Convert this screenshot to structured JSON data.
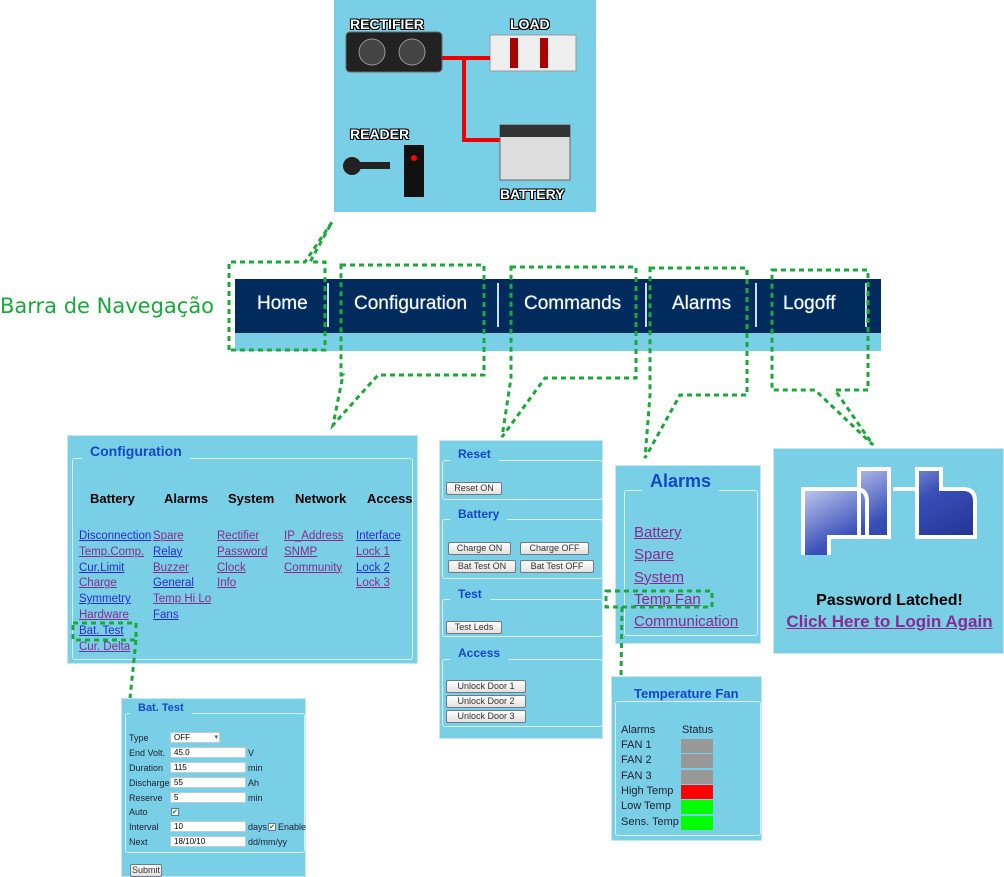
{
  "home": {
    "rectifier": "RECTIFIER",
    "load": "LOAD",
    "reader": "READER",
    "battery": "BATTERY"
  },
  "nav_label": "Barra de Navegação",
  "nav": [
    "Home",
    "Configuration",
    "Commands",
    "Alarms",
    "Logoff"
  ],
  "config": {
    "title": "Configuration",
    "columns": [
      {
        "header": "Battery",
        "links": [
          "Disconnection",
          "Temp.Comp.",
          "Cur.Limit",
          "Charge",
          "Symmetry",
          "Hardware",
          "Bat. Test",
          "Cur. Delta"
        ]
      },
      {
        "header": "Alarms",
        "links": [
          "Spare",
          "Relay",
          "Buzzer",
          "General",
          "Temp Hi Lo",
          "Fans"
        ]
      },
      {
        "header": "System",
        "links": [
          "Rectifier",
          "Password",
          "Clock",
          "Info"
        ]
      },
      {
        "header": "Network",
        "links": [
          "IP_Address",
          "SNMP",
          "Community"
        ]
      },
      {
        "header": "Access",
        "links": [
          "Interface",
          "Lock 1",
          "Lock 2",
          "Lock 3"
        ]
      }
    ]
  },
  "battest": {
    "title": "Bat. Test",
    "type_label": "Type",
    "type_value": "OFF",
    "fields": [
      {
        "label": "End Volt.",
        "value": "45.0",
        "unit": "V"
      },
      {
        "label": "Duration",
        "value": "115",
        "unit": "min"
      },
      {
        "label": "Discharge",
        "value": "55",
        "unit": "Ah"
      },
      {
        "label": "Reserve",
        "value": "5",
        "unit": "min"
      }
    ],
    "auto_label": "Auto",
    "interval_label": "Interval",
    "interval_value": "10",
    "interval_unit": "days",
    "enable_label": "Enable",
    "next_label": "Next",
    "next_value": "18/10/10",
    "next_unit": "dd/mm/yy",
    "submit": "Submit"
  },
  "commands": {
    "reset_title": "Reset",
    "reset_on": "Reset ON",
    "battery_title": "Battery",
    "charge_on": "Charge ON",
    "charge_off": "Charge OFF",
    "battest_on": "Bat Test ON",
    "battest_off": "Bat Test OFF",
    "test_title": "Test",
    "test_leds": "Test Leds",
    "access_title": "Access",
    "doors": [
      "Unlock Door 1",
      "Unlock Door 2",
      "Unlock Door 3"
    ]
  },
  "alarms": {
    "title": "Alarms",
    "links": [
      "Battery",
      "Spare",
      "System",
      "Temp Fan",
      "Communication"
    ]
  },
  "tempfan": {
    "title": "Temperature Fan",
    "col_alarms": "Alarms",
    "col_status": "Status",
    "rows": [
      {
        "name": "FAN 1",
        "color": "#999999"
      },
      {
        "name": "FAN 2",
        "color": "#999999"
      },
      {
        "name": "FAN 3",
        "color": "#999999"
      },
      {
        "name": "High Temp",
        "color": "#ff0000"
      },
      {
        "name": "Low Temp",
        "color": "#00ff00"
      },
      {
        "name": "Sens. Temp",
        "color": "#00ff00"
      }
    ]
  },
  "logoff": {
    "logo": "phb",
    "message": "Password Latched!",
    "login_link": "Click Here to Login Again"
  },
  "colors": {
    "panel": "#79cfe6",
    "nav": "#002b5c",
    "callout": "#1aa83c"
  }
}
